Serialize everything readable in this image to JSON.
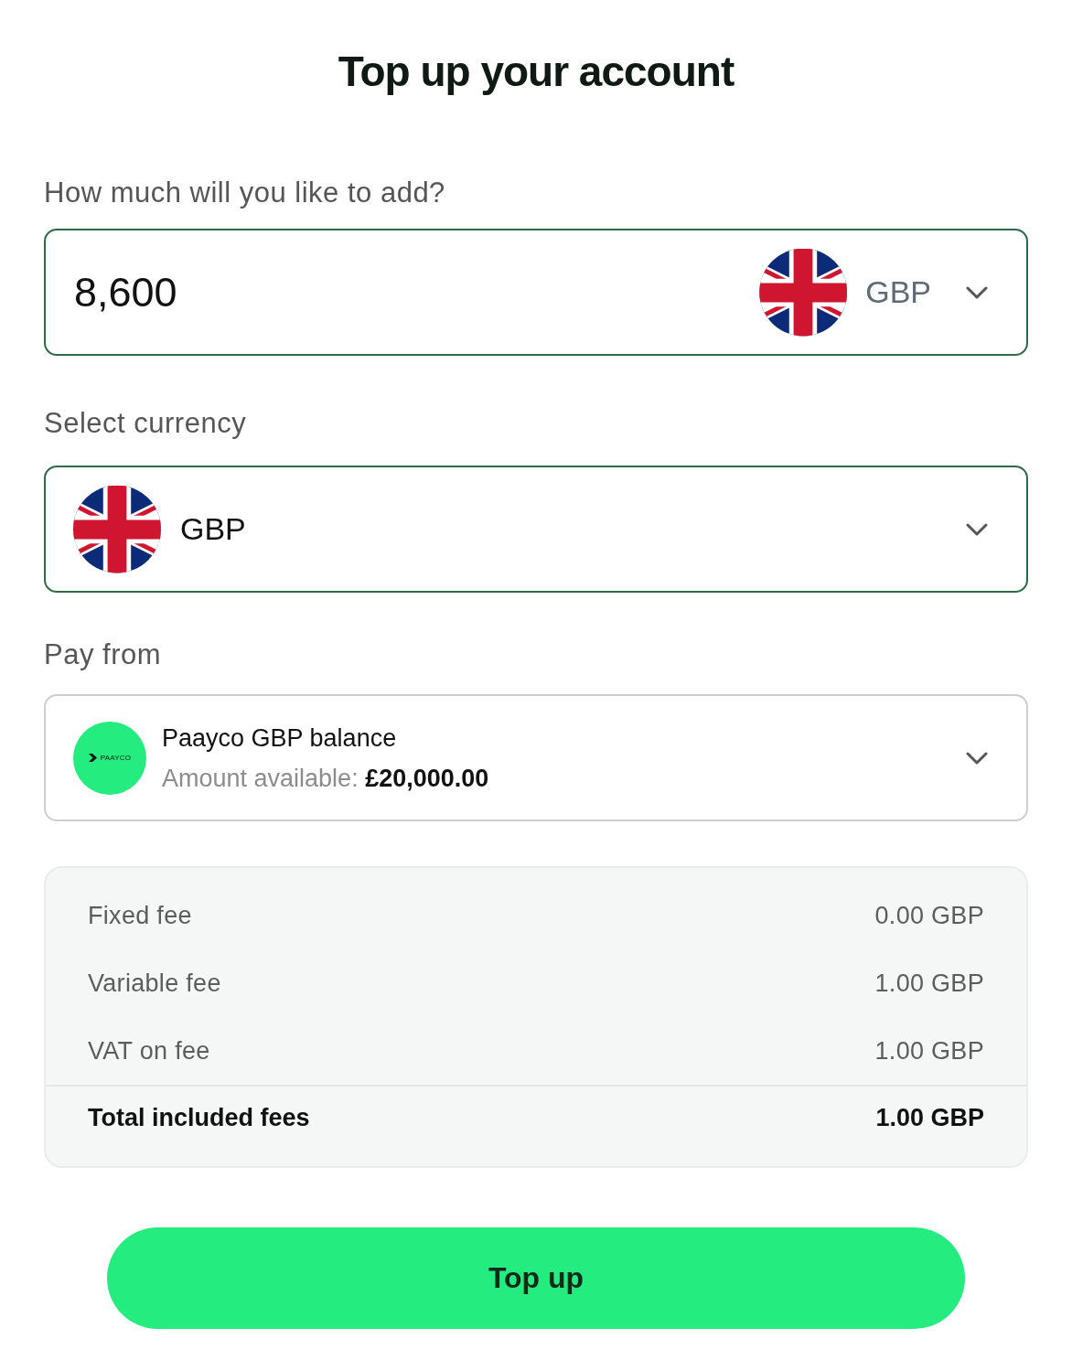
{
  "title": "Top up your account",
  "amount": {
    "label": "How much will you like to add?",
    "value": "8,600",
    "currency": "GBP"
  },
  "currency": {
    "label": "Select currency",
    "value": "GBP"
  },
  "pay_from": {
    "label": "Pay from",
    "logo_text": "PAAYCO",
    "account": "Paayco GBP balance",
    "available": "Amount available: **£20,000.00**"
  },
  "fees": [
    {
      "kind": "fee",
      "label": "Fixed fee",
      "value": "0.00 GBP"
    },
    {
      "kind": "fee",
      "label": "Variable fee",
      "value": "1.00 GBP"
    },
    {
      "kind": "fee",
      "label": "VAT on fee",
      "value": "1.00 GBP"
    },
    {
      "kind": "total",
      "label": "Total included fees",
      "value": "1.00 GBP"
    }
  ],
  "button": "Top up"
}
